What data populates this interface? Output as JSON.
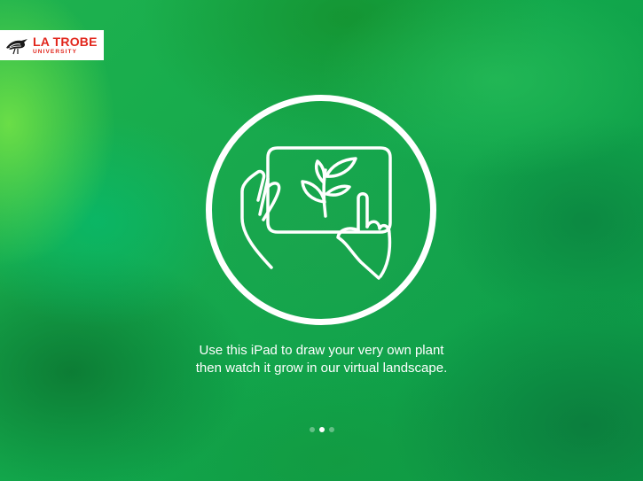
{
  "brand": {
    "name": "LA TROBE",
    "subtitle": "UNIVERSITY",
    "logo_icon": "la-trobe-bird-icon",
    "color": "#e1261c"
  },
  "illustration": {
    "icon": "hands-tablet-plant-icon",
    "stroke_color": "#ffffff"
  },
  "caption": {
    "line1": "Use this iPad to draw your very own plant",
    "line2": "then watch it grow in our virtual landscape."
  },
  "pagination": {
    "total": 3,
    "current": 2
  },
  "colors": {
    "background": "#12a84a",
    "text": "#ffffff"
  }
}
